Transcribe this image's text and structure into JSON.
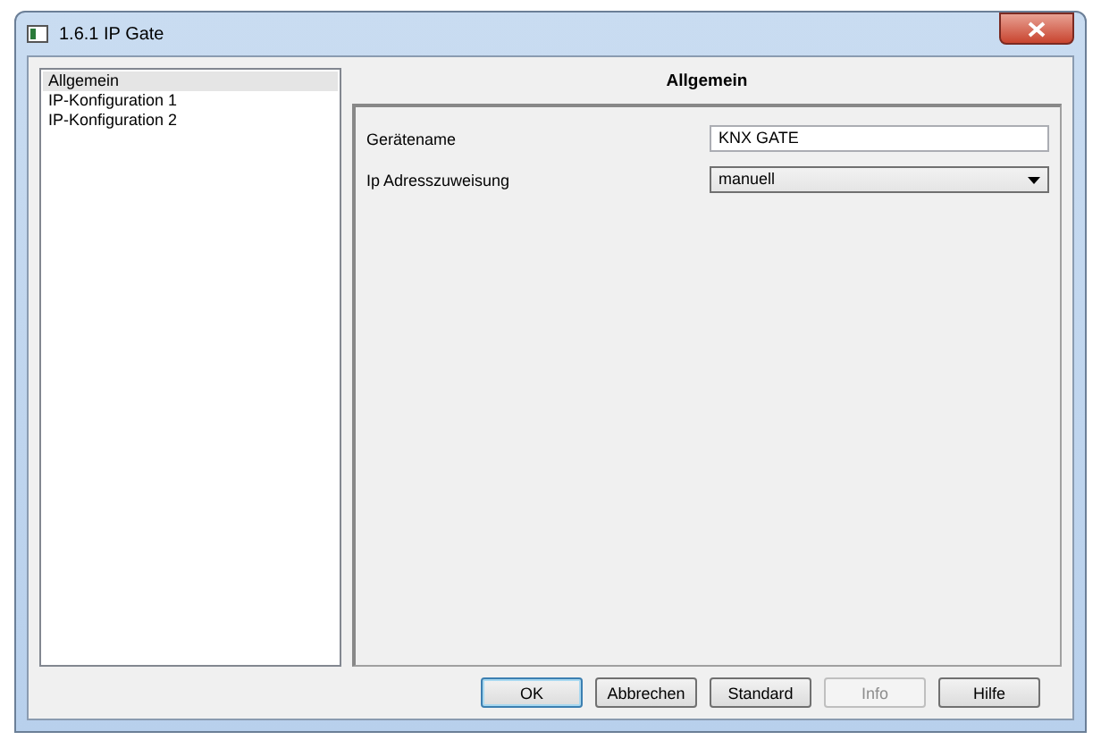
{
  "window": {
    "title": "1.6.1 IP Gate"
  },
  "sidebar": {
    "items": [
      {
        "label": "Allgemein",
        "selected": true
      },
      {
        "label": "IP-Konfiguration 1",
        "selected": false
      },
      {
        "label": "IP-Konfiguration 2",
        "selected": false
      }
    ]
  },
  "panel": {
    "heading": "Allgemein",
    "fields": [
      {
        "kind": "text",
        "label": "Gerätename",
        "value": "KNX GATE"
      },
      {
        "kind": "dropdown",
        "label": "Ip Adresszuweisung",
        "value": "manuell"
      }
    ]
  },
  "buttons": [
    {
      "label": "OK",
      "default": true,
      "disabled": false
    },
    {
      "label": "Abbrechen",
      "default": false,
      "disabled": false
    },
    {
      "label": "Standard",
      "default": false,
      "disabled": false
    },
    {
      "label": "Info",
      "default": false,
      "disabled": true
    },
    {
      "label": "Hilfe",
      "default": false,
      "disabled": false
    }
  ]
}
